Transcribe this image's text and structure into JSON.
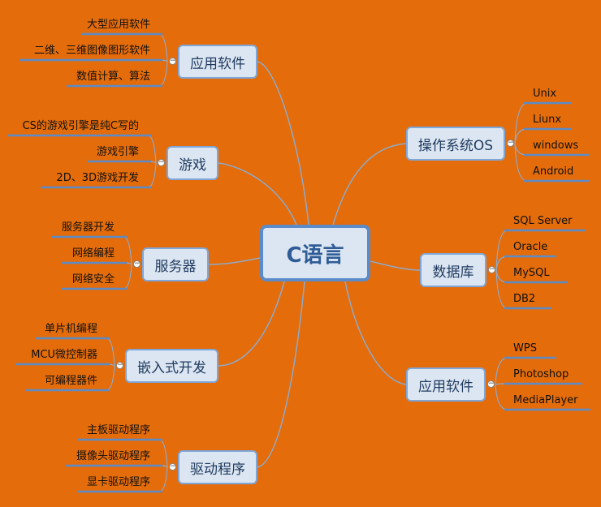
{
  "root": {
    "label": "C语言"
  },
  "left": [
    {
      "label": "应用软件",
      "children": [
        "大型应用软件",
        "二维、三维图像图形软件",
        "数值计算、算法"
      ]
    },
    {
      "label": "游戏",
      "children": [
        "CS的游戏引擎是纯C写的",
        "游戏引擎",
        "2D、3D游戏开发"
      ]
    },
    {
      "label": "服务器",
      "children": [
        "服务器开发",
        "网络编程",
        "网络安全"
      ]
    },
    {
      "label": "嵌入式开发",
      "children": [
        "单片机编程",
        "MCU微控制器",
        "可编程器件"
      ]
    },
    {
      "label": "驱动程序",
      "children": [
        "主板驱动程序",
        "摄像头驱动程序",
        "显卡驱动程序"
      ]
    }
  ],
  "right": [
    {
      "label": "操作系统OS",
      "children": [
        "Unix",
        "Liunx",
        "windows",
        "Android"
      ]
    },
    {
      "label": "数据库",
      "children": [
        "SQL Server",
        "Oracle",
        "MySQL",
        "DB2"
      ]
    },
    {
      "label": "应用软件",
      "children": [
        "WPS",
        "Photoshop",
        "MediaPlayer"
      ]
    }
  ],
  "colors": {
    "background": "#E46C0A",
    "node_fill": "#DCE6F2",
    "node_border": "#7EA6D8",
    "link": "#8FA9C9",
    "underline": "#5B8BC8"
  }
}
